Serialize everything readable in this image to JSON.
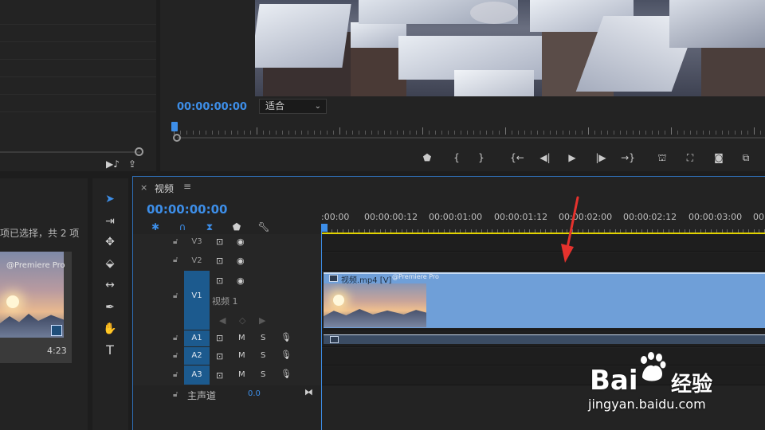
{
  "program": {
    "timecode": "00:00:00:00",
    "fit_option": "适合",
    "transport_icons": [
      "marker-icon",
      "in-point-icon",
      "out-point-icon",
      "go-to-in-icon",
      "step-back-icon",
      "play-icon",
      "step-forward-icon",
      "go-to-out-icon",
      "lift-icon",
      "extract-icon",
      "camera-icon",
      "multi-export-icon"
    ]
  },
  "project": {
    "selection_text": "项已选择，共 2 项",
    "thumb_watermark": "@Premiere Pro",
    "thumb_duration": "4:23"
  },
  "timeline": {
    "title": "视频",
    "menu_glyph": "≡",
    "close_glyph": "×",
    "timecode": "00:00:00:00",
    "ruler": [
      ":00:00",
      "00:00:00:12",
      "00:00:01:00",
      "00:00:01:12",
      "00:00:02:00",
      "00:00:02:12",
      "00:00:03:00",
      "00:0"
    ],
    "tracks": {
      "v3": "V3",
      "v2": "V2",
      "v1": "V1",
      "v1_name": "视频 1",
      "a1": "A1",
      "a2": "A2",
      "a3": "A3",
      "mute": "M",
      "solo": "S"
    },
    "clip_label": "视频.mp4 [V]",
    "clip_watermark": "@Premiere Pro",
    "master_label": "主声道",
    "master_value": "0.0"
  },
  "watermark": {
    "brand": "Bai",
    "brand_suffix": "经验",
    "url": "jingyan.baidu.com"
  },
  "colors": {
    "accent": "#3d8ee8",
    "clip_video": "#6f9fd8",
    "track_on": "#1c5a8e",
    "work_area": "#e2d300",
    "annotation_arrow": "#e5322d"
  }
}
